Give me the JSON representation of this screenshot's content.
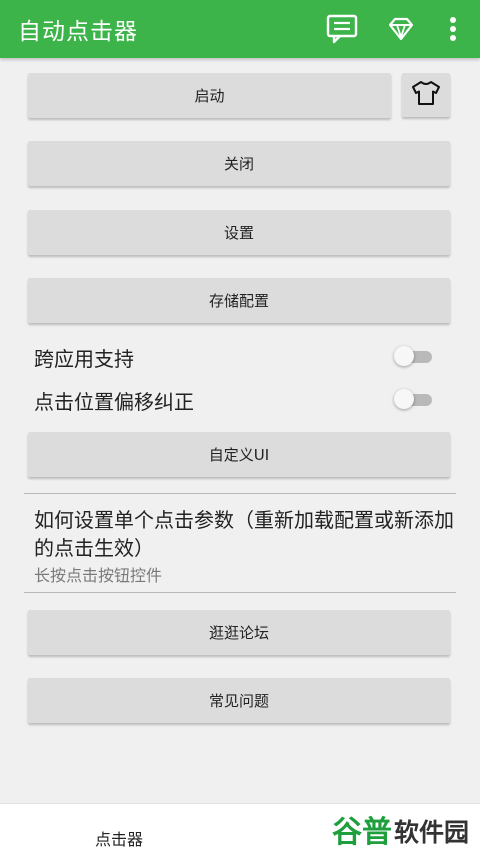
{
  "appbar": {
    "title": "自动点击器",
    "icons": [
      "chat-icon",
      "diamond-icon",
      "more-vert-icon"
    ],
    "color": "#3cb44a"
  },
  "buttons": {
    "start": "启动",
    "close": "关闭",
    "settings": "设置",
    "save_config": "存储配置",
    "custom_ui": "自定义UI",
    "forum": "逛逛论坛",
    "faq": "常见问题"
  },
  "toggles": {
    "cross_app": {
      "label": "跨应用支持",
      "on": false
    },
    "offset_correct": {
      "label": "点击位置偏移纠正",
      "on": false
    }
  },
  "help": {
    "title": "如何设置单个点击参数（重新加载配置或新添加的点击生效）",
    "subtitle": "长按点击按钮控件"
  },
  "bottom": {
    "tab_label": "点击器",
    "watermark": "谷普软件园"
  }
}
